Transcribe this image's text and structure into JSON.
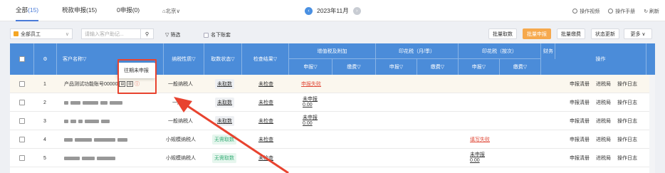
{
  "tabs": [
    {
      "label": "全部",
      "count": "(15)"
    },
    {
      "label": "税款申报(15)",
      "count": ""
    },
    {
      "label": "0申报(0)",
      "count": ""
    }
  ],
  "region": "北京",
  "month": "2023年11月",
  "top_links": [
    "操作视频",
    "操作手册",
    "刷新"
  ],
  "filters": {
    "staff": "全部员工",
    "search_placeholder": "请输入客户助记...",
    "filter_label": "筛选",
    "under_name_label": "名下账套"
  },
  "actions": [
    "批量取数",
    "批量申报",
    "批量缴费",
    "状态更新",
    "更多"
  ],
  "header": {
    "customer": "客户名称",
    "taxpayer": "纳税性质",
    "fetch": "取数状态",
    "check": "检查结果",
    "vat": "增值税及附加",
    "stamp_month": "印花税（月/季）",
    "stamp_count": "印花税（按次）",
    "finance": "财务",
    "ops": "操作",
    "declare": "申报",
    "pay": "缴费"
  },
  "tooltip": "往期未申报",
  "rows": [
    {
      "no": "1",
      "name": "产品测试功能账号00000",
      "type": "一般纳税人",
      "fetch": "未取数",
      "check": "未检查",
      "vat_declare": "申报失败",
      "stamp2": ""
    },
    {
      "no": "2",
      "name": "",
      "type": "一般纳",
      "fetch": "未取数",
      "check": "未检查",
      "vat_declare": "未申报 0.00",
      "stamp2": ""
    },
    {
      "no": "3",
      "name": "",
      "type": "一般纳税人",
      "fetch": "未取数",
      "check": "未检查",
      "vat_declare": "未申报 0.00",
      "stamp2": ""
    },
    {
      "no": "4",
      "name": "",
      "type": "小规模纳税人",
      "fetch": "无需取数",
      "check": "未检查",
      "vat_declare": "",
      "stamp2": "填写失败"
    },
    {
      "no": "5",
      "name": "",
      "type": "小规模纳税人",
      "fetch": "无需取数",
      "check": "未检查",
      "vat_declare": "",
      "stamp2": "未申报 0.00"
    }
  ],
  "ops": [
    "申报清册",
    "进税局",
    "操作日志"
  ]
}
